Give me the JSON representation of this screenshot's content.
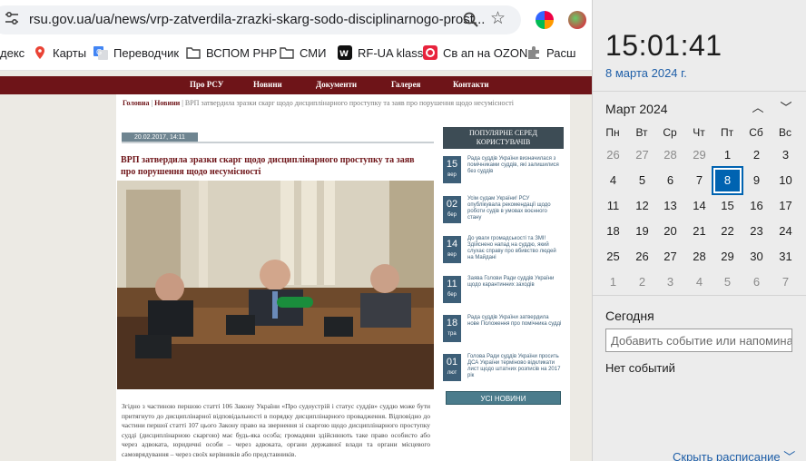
{
  "browser": {
    "url": "rsu.gov.ua/ua/news/vrp-zatverdila-zrazki-skarg-sodo-disciplinarnogo-prost...",
    "bookmarks": [
      {
        "label": "декс",
        "icon": "yandex-icon"
      },
      {
        "label": "Карты",
        "icon": "maps-icon"
      },
      {
        "label": "Переводчик",
        "icon": "translate-icon"
      },
      {
        "label": "ВСПОМ PHP",
        "icon": "folder-icon"
      },
      {
        "label": "СМИ",
        "icon": "folder-icon"
      },
      {
        "label": "RF-UA klass",
        "icon": "vk-icon"
      },
      {
        "label": "Св ап на OZON",
        "icon": "ozon-icon"
      },
      {
        "label": "Расш",
        "icon": "extension-icon"
      }
    ]
  },
  "site": {
    "nav": [
      "Про РСУ",
      "Новини",
      "Документи",
      "Галерея",
      "Контакти"
    ],
    "breadcrumb": {
      "home": "Головна",
      "sep1": " | ",
      "section": "Новини",
      "sep2": " | ",
      "current": "ВРП затвердила зразки скарг щодо дисциплінарного проступку та заяв про порушення щодо несумісності"
    },
    "article": {
      "date": "20.02.2017, 14:11",
      "title": "ВРП затвердила зразки скарг щодо дисциплінарного проступку та заяв про порушення щодо несумісності",
      "body": "Згідно з частиною першою статті 106 Закону України «Про судоустрій і статус суддів» суддю може бути притягнуто до дисциплінарної відповідальності в порядку дисциплінарного провадження. Відповідно до частини першої статті 107 цього Закону право на звернення зі скаргою щодо дисциплінарного проступку судді (дисциплінарною скаргою) має будь-яка особа; громадяни здійснюють таке право особисто або через адвоката, юридичні особи – через адвоката, органи державної влади та органи місцевого самоврядування – через своїх керівників або представників."
    },
    "popular": {
      "title": "ПОПУЛЯРНЕ СЕРЕД КОРИСТУВАЧІВ",
      "items": [
        {
          "day": "15",
          "month": "вер",
          "text": "Рада суддів України визначилася з помічниками суддів, які залишилися без суддів"
        },
        {
          "day": "02",
          "month": "бер",
          "text": "Усім судам України! РСУ опублікувала рекомендації щодо роботи судів в умовах воєнного стану"
        },
        {
          "day": "14",
          "month": "вер",
          "text": "До уваги громадськості та ЗМІ! Здійснено напад на суддю, який слухає справу про вбивство людей на Майдані"
        },
        {
          "day": "11",
          "month": "бер",
          "text": "Заява Голови Ради суддів України щодо карантинних заходів"
        },
        {
          "day": "18",
          "month": "тра",
          "text": "Рада суддів України затвердила нове Положення про помічника судді"
        },
        {
          "day": "01",
          "month": "лют",
          "text": "Голова Ради суддів України просить ДСА України терміново відкликати лист щодо штатних розписів на 2017 рік"
        }
      ],
      "all_news": "УСІ НОВИНИ"
    }
  },
  "calendar": {
    "time": "15:01:41",
    "date_long": "8 марта 2024 г.",
    "month_title": "Март 2024",
    "weekdays": [
      "Пн",
      "Вт",
      "Ср",
      "Чт",
      "Пт",
      "Сб",
      "Вс"
    ],
    "weeks": [
      [
        "26",
        "27",
        "28",
        "29",
        "1",
        "2",
        "3"
      ],
      [
        "4",
        "5",
        "6",
        "7",
        "8",
        "9",
        "10"
      ],
      [
        "11",
        "12",
        "13",
        "14",
        "15",
        "16",
        "17"
      ],
      [
        "18",
        "19",
        "20",
        "21",
        "22",
        "23",
        "24"
      ],
      [
        "25",
        "26",
        "27",
        "28",
        "29",
        "30",
        "31"
      ],
      [
        "1",
        "2",
        "3",
        "4",
        "5",
        "6",
        "7"
      ]
    ],
    "today": "8",
    "agenda_title": "Сегодня",
    "add_event_placeholder": "Добавить событие или напоминание",
    "no_events": "Нет событий",
    "hide_schedule": "Скрыть расписание",
    "accent": "#0063b1"
  }
}
